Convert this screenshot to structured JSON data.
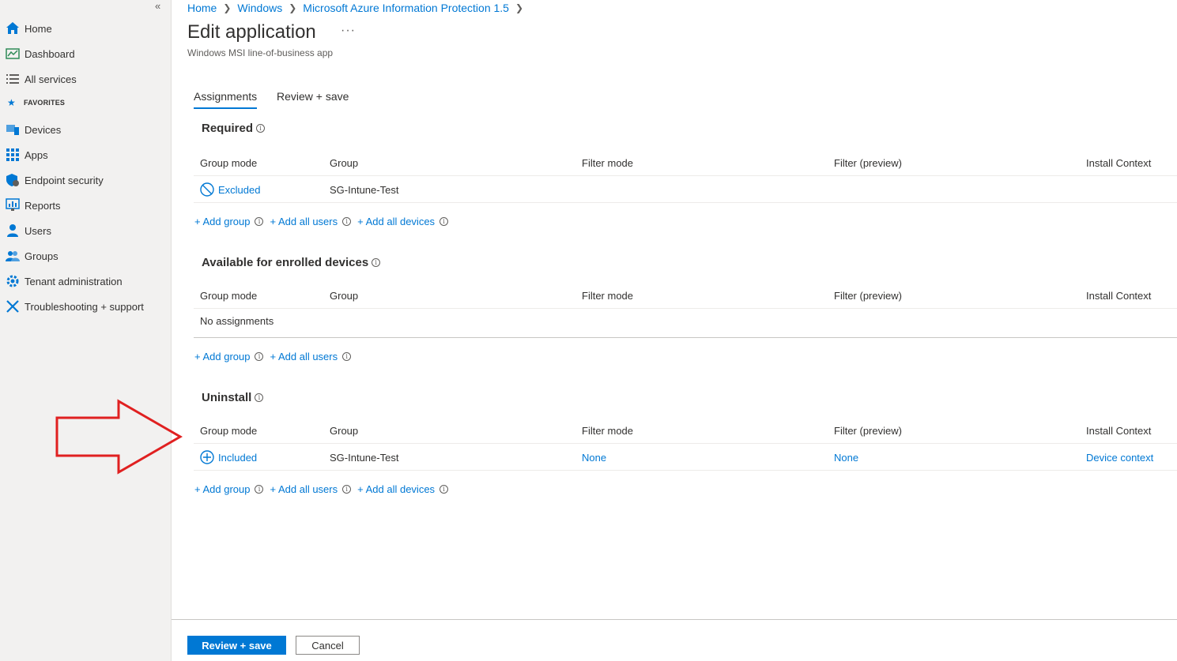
{
  "sidebar": {
    "collapse_label": "«",
    "items": [
      {
        "label": "Home",
        "icon": "home-icon"
      },
      {
        "label": "Dashboard",
        "icon": "dashboard-icon"
      },
      {
        "label": "All services",
        "icon": "list-icon"
      }
    ],
    "favorites_label": "FAVORITES",
    "favorites": [
      {
        "label": "Devices",
        "icon": "devices-icon"
      },
      {
        "label": "Apps",
        "icon": "apps-icon"
      },
      {
        "label": "Endpoint security",
        "icon": "shield-icon"
      },
      {
        "label": "Reports",
        "icon": "reports-icon"
      },
      {
        "label": "Users",
        "icon": "user-icon"
      },
      {
        "label": "Groups",
        "icon": "groups-icon"
      },
      {
        "label": "Tenant administration",
        "icon": "tenant-admin-icon"
      },
      {
        "label": "Troubleshooting + support",
        "icon": "tools-icon"
      }
    ]
  },
  "breadcrumb": [
    "Home",
    "Windows",
    "Microsoft Azure Information Protection 1.5"
  ],
  "page": {
    "title": "Edit application",
    "more_label": "···",
    "subtitle": "Windows MSI line-of-business app"
  },
  "tabs": [
    "Assignments",
    "Review + save"
  ],
  "columns": [
    "Group mode",
    "Group",
    "Filter mode",
    "Filter (preview)",
    "Install Context"
  ],
  "info_glyph": "i",
  "sections": {
    "required": {
      "title": "Required",
      "row": {
        "mode": "Excluded",
        "group": "SG-Intune-Test",
        "filter_mode": "",
        "filter": "",
        "context": ""
      },
      "add": [
        "+ Add group",
        "+ Add all users",
        "+ Add all devices"
      ]
    },
    "available": {
      "title": "Available for enrolled devices",
      "empty": "No assignments",
      "add": [
        "+ Add group",
        "+ Add all users"
      ]
    },
    "uninstall": {
      "title": "Uninstall",
      "row": {
        "mode": "Included",
        "group": "SG-Intune-Test",
        "filter_mode": "None",
        "filter": "None",
        "context": "Device context"
      },
      "add": [
        "+ Add group",
        "+ Add all users",
        "+ Add all devices"
      ]
    }
  },
  "footer": {
    "primary": "Review + save",
    "cancel": "Cancel"
  },
  "colors": {
    "accent": "#0078d4",
    "annotation_arrow": "#e02020",
    "sidebar_bg": "#f2f1f0"
  }
}
